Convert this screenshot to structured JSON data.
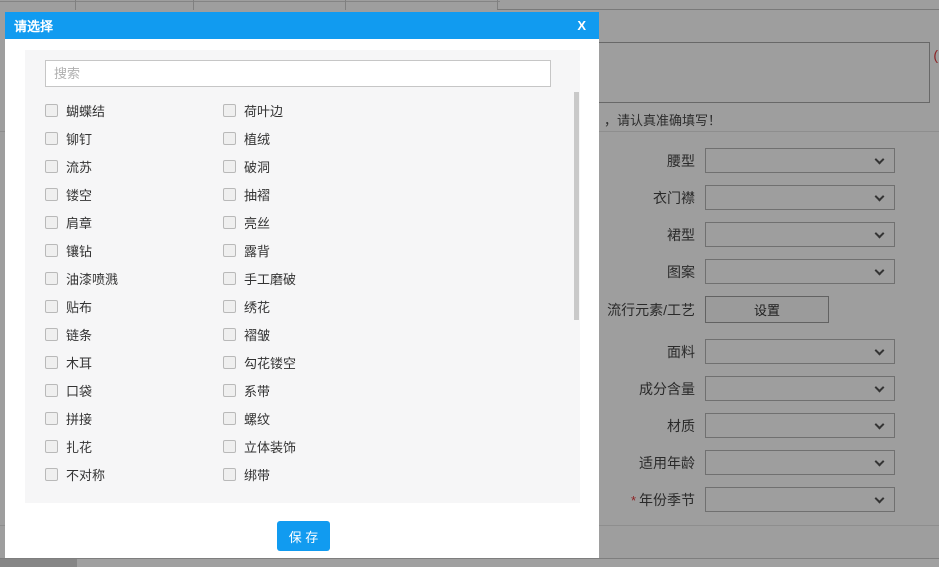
{
  "modal": {
    "title": "请选择",
    "close": "X",
    "search": {
      "placeholder": "搜索"
    },
    "options": [
      "蝴蝶结",
      "荷叶边",
      "铆钉",
      "植绒",
      "流苏",
      "破洞",
      "镂空",
      "抽褶",
      "肩章",
      "亮丝",
      "镶钻",
      "露背",
      "油漆喷溅",
      "手工磨破",
      "贴布",
      "绣花",
      "链条",
      "褶皱",
      "木耳",
      "勾花镂空",
      "口袋",
      "系带",
      "拼接",
      "螺纹",
      "扎花",
      "立体装饰",
      "不对称",
      "绑带"
    ],
    "save_label": "保 存"
  },
  "background_form": {
    "note": "，请认真准确填写！",
    "paren": "(",
    "required_marker": "*",
    "fields": [
      {
        "label": "腰型",
        "control": "select"
      },
      {
        "label": "衣门襟",
        "control": "select"
      },
      {
        "label": "裙型",
        "control": "select"
      },
      {
        "label": "图案",
        "control": "select"
      },
      {
        "label": "流行元素/工艺",
        "control": "button",
        "button_label": "设置"
      },
      {
        "label": "面料",
        "control": "select"
      },
      {
        "label": "成分含量",
        "control": "select"
      },
      {
        "label": "材质",
        "control": "select"
      },
      {
        "label": "适用年龄",
        "control": "select"
      },
      {
        "label": "年份季节",
        "control": "select",
        "required": true
      }
    ]
  },
  "colors": {
    "accent_blue": "#119bf0",
    "required_red": "#e4393c"
  }
}
